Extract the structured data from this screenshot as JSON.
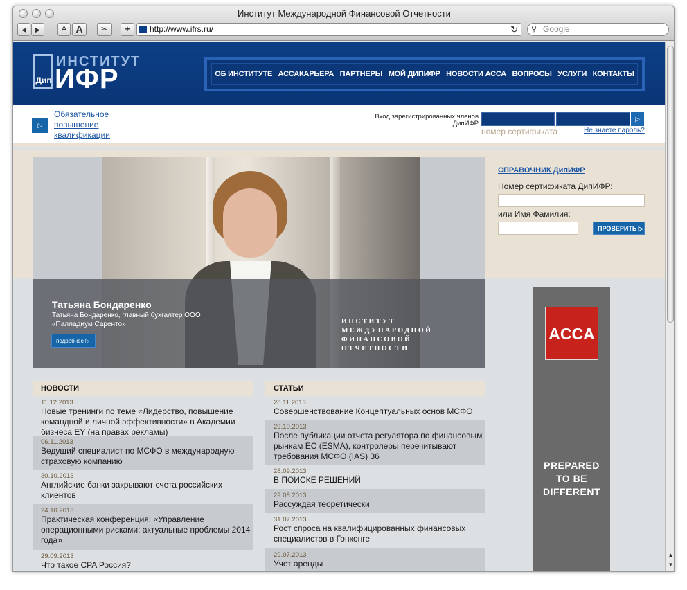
{
  "browser": {
    "window_title": "Институт Международной Финансовой Отчетности",
    "back": "◀",
    "forward": "▶",
    "font_small": "A",
    "font_large": "A",
    "snip": "✂",
    "add": "+",
    "url": "http://www.ifrs.ru/",
    "reload": "↻",
    "search_placeholder": "Google"
  },
  "logo": {
    "dip": "Дип",
    "institut": "ИНСТИТУТ",
    "ifr": "ИФР"
  },
  "nav": [
    "ОБ ИНСТИТУТЕ",
    "АССАКАРЬЕРА",
    "ПАРТНЕРЫ",
    "МОЙ ДИПИФР",
    "НОВОСТИ АССА",
    "ВОПРОСЫ",
    "УСЛУГИ",
    "КОНТАКТЫ"
  ],
  "subheader": {
    "mandatory_link": "Обязательное повышение квалификации",
    "login_label": "Вход зарегистрированных членов ДипИФР",
    "cert_placeholder": "номер сертификата",
    "forgot": "Не знаете пароль?"
  },
  "hero": {
    "name": "Татьяна Бондаренко",
    "desc": "Татьяна Бондаренко, главный бухгалтер ООО «Палладиум Саренто»",
    "more_btn": "подробнее",
    "institute_line1": "ИНСТИТУТ",
    "institute_line2": "МЕЖДУНАРОДНОЙ",
    "institute_line3": "ФИНАНСОВОЙ",
    "institute_line4": "ОТЧЕТНОСТИ"
  },
  "directory": {
    "title": "СПРАВОЧНИК ДипИФР",
    "label1": "Номер сертификата ДипИФР:",
    "label2": "или Имя Фамилия:",
    "check_btn": "ПРОВЕРИТЬ"
  },
  "banner": {
    "logo": "ACCA",
    "line1": "PREPARED",
    "line2": "TO BE",
    "line3": "DIFFERENT"
  },
  "news": {
    "title": "НОВОСТИ",
    "items": [
      {
        "date": "11.12.2013",
        "text": "Новые тренинги по теме «Лидерство, повышение командной и личной эффективности» в Академии бизнеса EY (на правах рекламы)"
      },
      {
        "date": "06.11.2013",
        "text": "Ведущий специалист по МСФО в международную страховую компанию"
      },
      {
        "date": "30.10.2013",
        "text": "Английские банки закрывают счета российских клиентов"
      },
      {
        "date": "24.10.2013",
        "text": "Практическая конференция: «Управление операционными рисками: актуальные проблемы 2014 года»"
      },
      {
        "date": "29.09.2013",
        "text": "Что такое CPA Россия?"
      }
    ]
  },
  "articles": {
    "title": "СТАТЬИ",
    "items": [
      {
        "date": "28.11.2013",
        "text": "Совершенствование Концептуальных основ МСФО"
      },
      {
        "date": "29.10.2013",
        "text": "После публикации отчета регулятора по финансовым рынкам ЕС (ESMA), контролеры перечитывают требования МСФО (IAS) 36"
      },
      {
        "date": "28.09.2013",
        "text": "В ПОИСКЕ РЕШЕНИЙ"
      },
      {
        "date": "29.08.2013",
        "text": "Рассуждая теоретически"
      },
      {
        "date": "31.07.2013",
        "text": "Рост спроса на квалифицированных финансовых специалистов в Гонконге"
      },
      {
        "date": "29.07.2013",
        "text": "Учет аренды"
      }
    ]
  }
}
